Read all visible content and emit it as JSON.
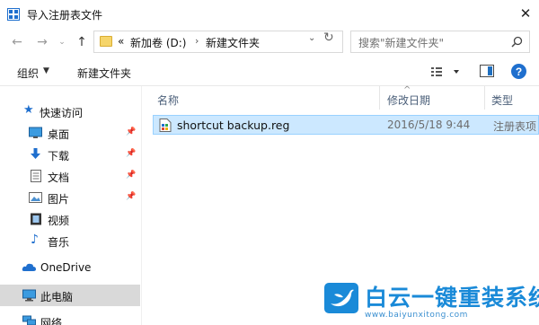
{
  "window": {
    "title": "导入注册表文件"
  },
  "address": {
    "overflow": "«",
    "crumbs": [
      "新加卷 (D:)",
      "新建文件夹"
    ]
  },
  "search": {
    "placeholder": "搜索\"新建文件夹\""
  },
  "toolbar": {
    "organize_label": "组织",
    "new_folder_label": "新建文件夹"
  },
  "sidebar": {
    "quick_access": "快速访问",
    "items": [
      {
        "label": "桌面",
        "icon": "desktop-icon"
      },
      {
        "label": "下载",
        "icon": "download-icon"
      },
      {
        "label": "文档",
        "icon": "documents-icon"
      },
      {
        "label": "图片",
        "icon": "pictures-icon"
      },
      {
        "label": "视频",
        "icon": "videos-icon"
      },
      {
        "label": "音乐",
        "icon": "music-icon"
      }
    ],
    "onedrive": "OneDrive",
    "this_pc": "此电脑",
    "network": "网络"
  },
  "columns": {
    "name": "名称",
    "modified": "修改日期",
    "type": "类型"
  },
  "files": [
    {
      "name": "shortcut backup.reg",
      "modified": "2016/5/18 9:44",
      "type": "注册表项"
    }
  ],
  "watermark": {
    "title": "白云一键重装系统",
    "url": "www.baiyunxitong.com"
  },
  "colors": {
    "accent": "#1f6fce",
    "selection": "#cce8ff",
    "selection_border": "#99d1ff",
    "header_text": "#4c607a",
    "watermark": "#1a8ad8"
  }
}
